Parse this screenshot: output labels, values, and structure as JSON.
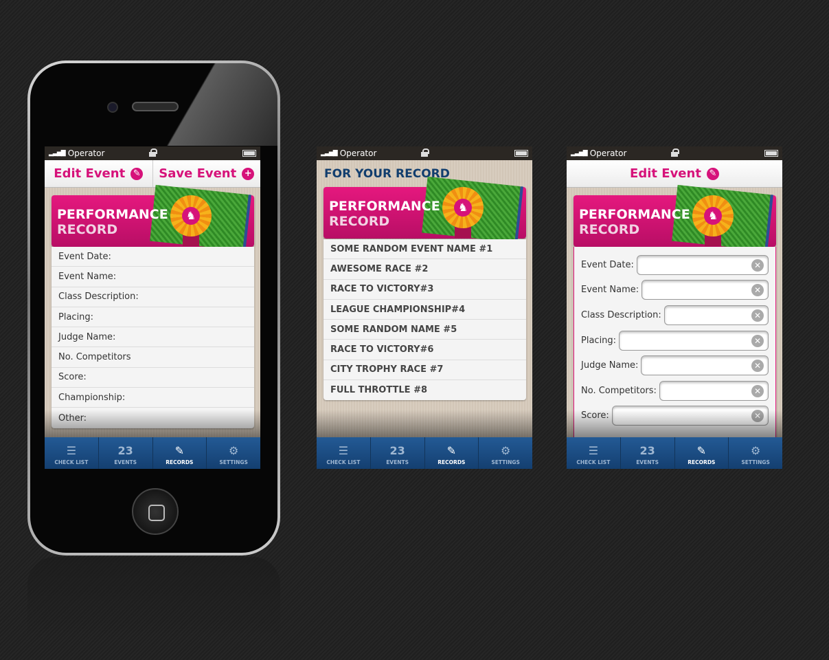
{
  "status_bar": {
    "carrier": "Operator"
  },
  "tab_bar": {
    "items": [
      {
        "label": "CHECK LIST",
        "icon": "list-icon",
        "glyph": "☰"
      },
      {
        "label": "EVENTS",
        "icon": "calendar-icon",
        "glyph": "23"
      },
      {
        "label": "RECORDS",
        "icon": "records-scroll-icon",
        "glyph": "✎"
      },
      {
        "label": "SETTINGS",
        "icon": "gear-icon",
        "glyph": "⚙"
      }
    ],
    "active": "RECORDS"
  },
  "banner": {
    "line1": "PERFORMANCE",
    "line2": "RECORD"
  },
  "colors": {
    "accent": "#d6127a",
    "tab_bar": "#1d4f86",
    "title": "#123e6e"
  },
  "screen1": {
    "header": {
      "edit_label": "Edit Event",
      "edit_icon": "pencil-icon",
      "save_label": "Save Event",
      "save_icon": "plus-circle-icon"
    },
    "fields": [
      "Event Date:",
      "Event Name:",
      "Class Description:",
      "Placing:",
      "Judge Name:",
      "No. Competitors",
      "Score:",
      "Championship:",
      "Other:"
    ]
  },
  "screen2": {
    "title": "FOR YOUR RECORD",
    "events": [
      "SOME RANDOM EVENT NAME #1",
      "AWESOME RACE #2",
      "RACE TO VICTORY#3",
      "LEAGUE CHAMPIONSHIP#4",
      "SOME RANDOM NAME #5",
      "RACE TO VICTORY#6",
      "CITY TROPHY RACE #7",
      "FULL THROTTLE #8"
    ]
  },
  "screen3": {
    "header": {
      "edit_label": "Edit Event",
      "edit_icon": "pencil-icon"
    },
    "fields": [
      {
        "label": "Event Date:",
        "value": ""
      },
      {
        "label": "Event Name:",
        "value": ""
      },
      {
        "label": "Class Description:",
        "value": ""
      },
      {
        "label": "Placing:",
        "value": ""
      },
      {
        "label": "Judge Name:",
        "value": ""
      },
      {
        "label": "No. Competitors:",
        "value": ""
      },
      {
        "label": "Score:",
        "value": ""
      }
    ]
  }
}
